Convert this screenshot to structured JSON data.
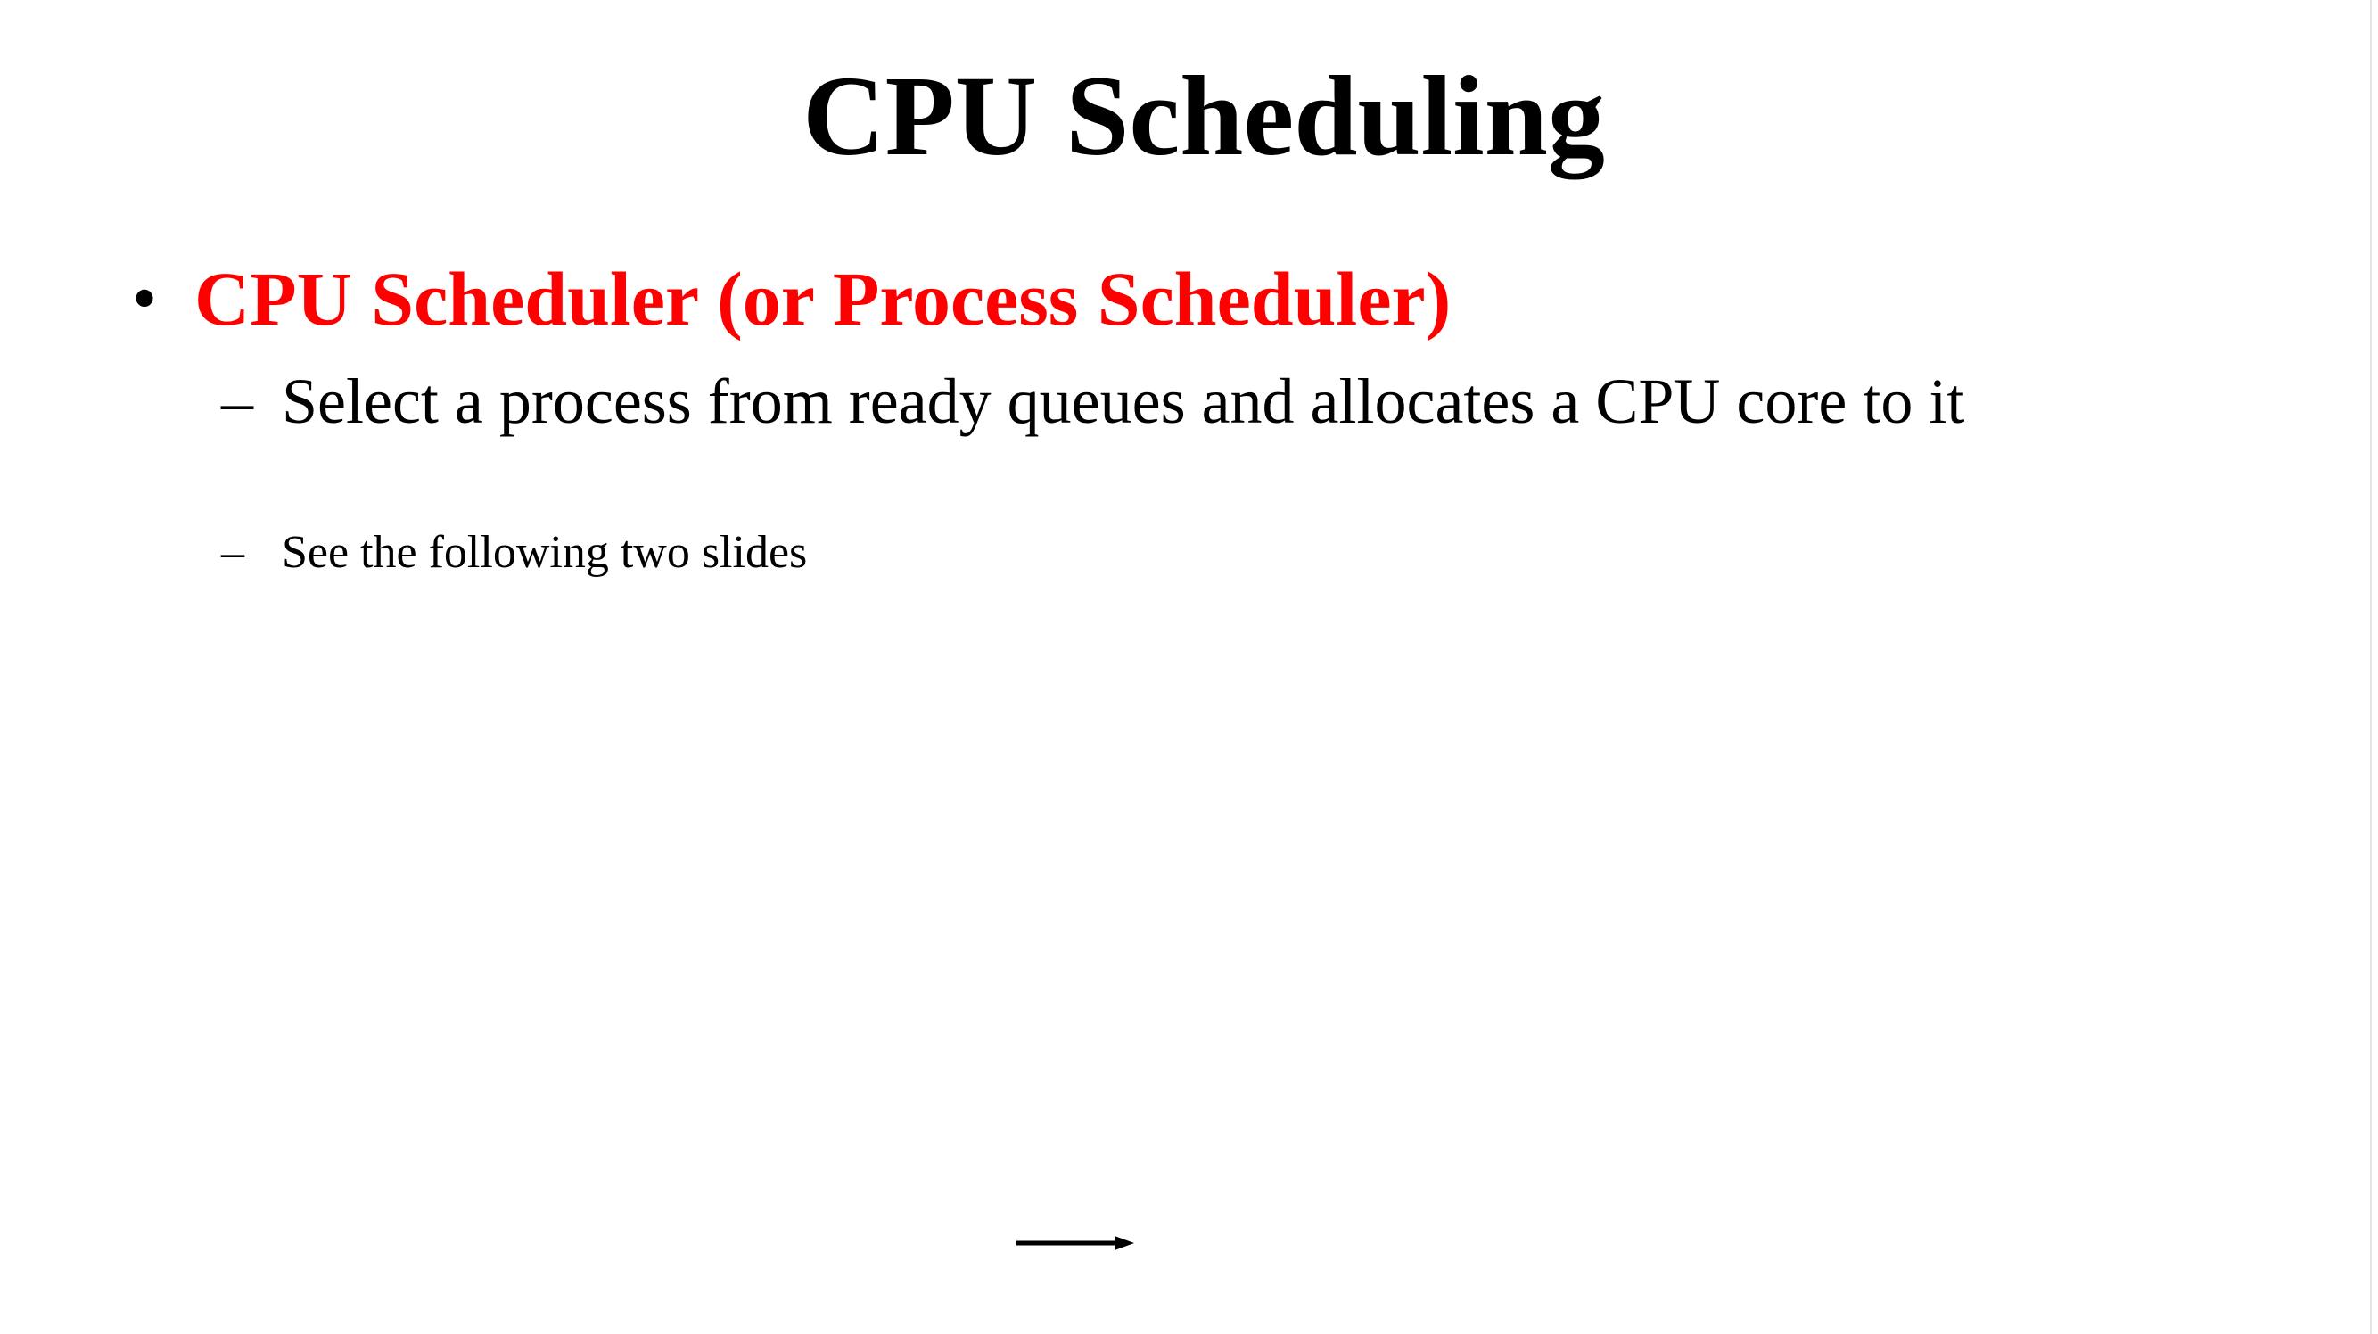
{
  "slide": {
    "title": "CPU Scheduling",
    "bullets": [
      {
        "marker": "•",
        "text": "CPU Scheduler (or Process Scheduler)",
        "color": "#ff0000",
        "subitems": [
          {
            "marker": "–",
            "text": "Select a process from ready queues and allocates a CPU core to it"
          },
          {
            "marker": "–",
            "text": "See the following two slides"
          }
        ]
      }
    ],
    "icons": {
      "arrow": "right-arrow-icon"
    }
  }
}
